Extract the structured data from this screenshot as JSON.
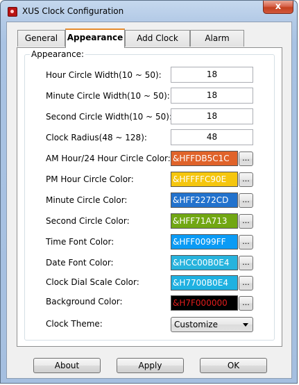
{
  "window": {
    "title": "XUS Clock Configuration",
    "close_label": "x"
  },
  "tabs": [
    {
      "label": "General",
      "active": false
    },
    {
      "label": "Appearance",
      "active": true
    },
    {
      "label": "Add Clock",
      "active": false
    },
    {
      "label": "Alarm",
      "active": false
    }
  ],
  "group": {
    "title": "Appearance:"
  },
  "fields": {
    "hour_width": {
      "label": "Hour Circle Width(10 ~ 50):",
      "value": "18"
    },
    "minute_width": {
      "label": "Minute Circle Width(10 ~ 50):",
      "value": "18"
    },
    "second_width": {
      "label": "Second Circle Width(10 ~ 50):",
      "value": "18"
    },
    "radius": {
      "label": "Clock Radius(48 ~ 128):",
      "value": "48"
    }
  },
  "colors": [
    {
      "label": "AM Hour/24 Hour Circle Color:",
      "value": "&HFFDB5C1C",
      "bg": "#e0632a",
      "fg": "#ffffff"
    },
    {
      "label": "PM Hour Circle Color:",
      "value": "&HFFFFC90E",
      "bg": "#f5c60e",
      "fg": "#ffffff"
    },
    {
      "label": "Minute Circle Color:",
      "value": "&HFF2272CD",
      "bg": "#2272cd",
      "fg": "#ffffff"
    },
    {
      "label": "Second Circle Color:",
      "value": "&HFF71A713",
      "bg": "#71a713",
      "fg": "#ffffff"
    },
    {
      "label": "Time Font Color:",
      "value": "&HFF0099FF",
      "bg": "#0a9bf5",
      "fg": "#ffffff"
    },
    {
      "label": "Date Font Color:",
      "value": "&HCC00B0E4",
      "bg": "#27b3dd",
      "fg": "#ffffff"
    },
    {
      "label": "Clock Dial Scale Color:",
      "value": "&H7700B0E4",
      "bg": "#1fb1e1",
      "fg": "#ffffff"
    },
    {
      "label": "Background Color:",
      "value": "&H7F000000",
      "bg": "#000000",
      "fg": "#e21c1c"
    }
  ],
  "color_button_label": "...",
  "theme": {
    "label": "Clock Theme:",
    "selected": "Customize"
  },
  "buttons": {
    "about": "About",
    "apply": "Apply",
    "ok": "OK"
  }
}
